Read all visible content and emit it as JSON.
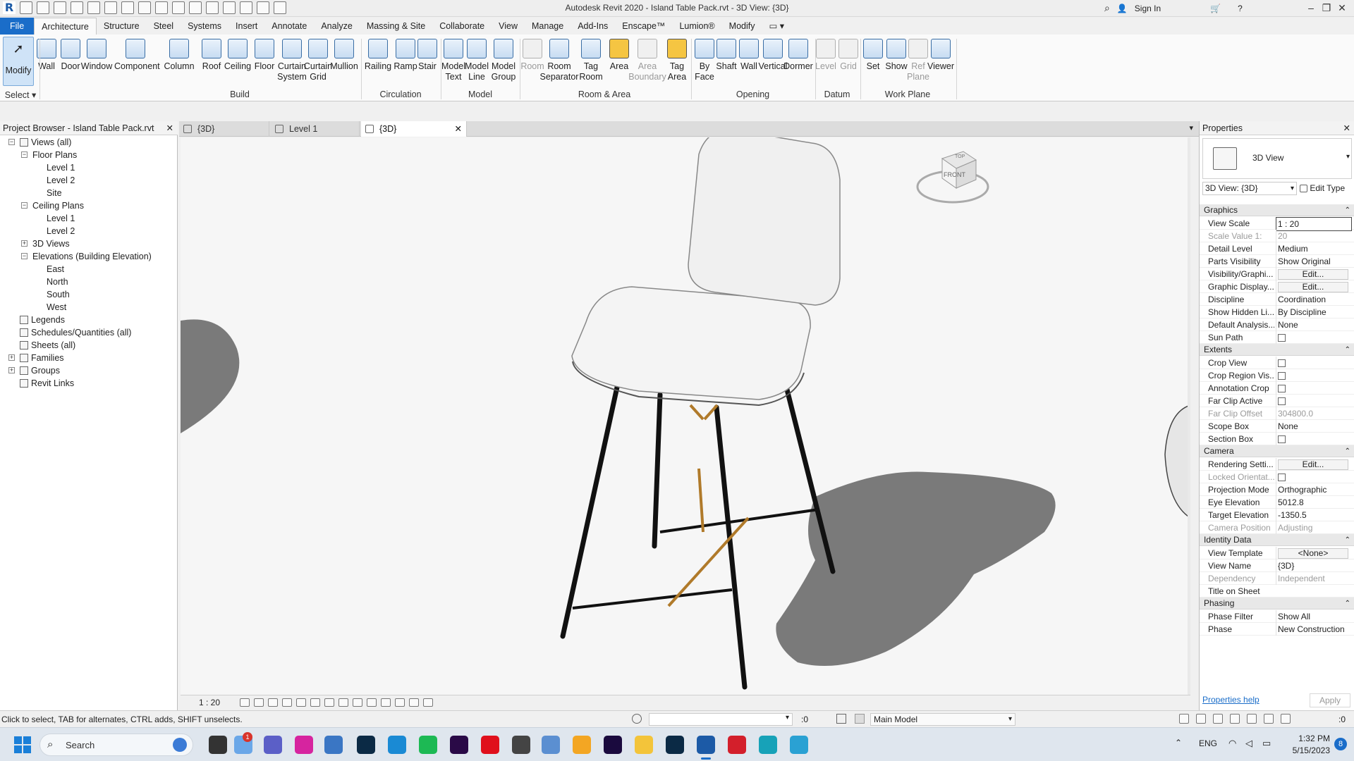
{
  "titlebar": {
    "app_title": "Autodesk Revit 2020 - Island Table Pack.rvt - 3D View: {3D}",
    "sign_in": "Sign In",
    "minimize": "–",
    "restore": "❐",
    "close": "✕"
  },
  "ribbon_tabs": [
    "File",
    "Architecture",
    "Structure",
    "Steel",
    "Systems",
    "Insert",
    "Annotate",
    "Analyze",
    "Massing & Site",
    "Collaborate",
    "View",
    "Manage",
    "Add-Ins",
    "Enscape™",
    "Lumion®",
    "Modify"
  ],
  "ribbon": {
    "select": {
      "modify": "Modify",
      "label": "Select"
    },
    "build": {
      "label": "Build",
      "buttons": [
        "Wall",
        "Door",
        "Window",
        "Component",
        "Column",
        "Roof",
        "Ceiling",
        "Floor",
        "Curtain\nSystem",
        "Curtain\nGrid",
        "Mullion"
      ]
    },
    "circulation": {
      "label": "Circulation",
      "buttons": [
        "Railing",
        "Ramp",
        "Stair"
      ]
    },
    "model": {
      "label": "Model",
      "buttons": [
        "Model\nText",
        "Model\nLine",
        "Model\nGroup"
      ]
    },
    "room_area": {
      "label": "Room & Area",
      "buttons": [
        "Room",
        "Room\nSeparator",
        "Tag\nRoom",
        "Area",
        "Area\nBoundary",
        "Tag\nArea"
      ]
    },
    "opening": {
      "label": "Opening",
      "buttons": [
        "By\nFace",
        "Shaft",
        "Wall",
        "Vertical",
        "Dormer"
      ]
    },
    "datum": {
      "label": "Datum",
      "buttons": [
        "Level",
        "Grid"
      ]
    },
    "work_plane": {
      "label": "Work Plane",
      "buttons": [
        "Set",
        "Show",
        "Ref\nPlane",
        "Viewer"
      ]
    }
  },
  "project_browser": {
    "title": "Project Browser - Island Table Pack.rvt",
    "close": "✕",
    "tree": [
      {
        "label": "Views (all)",
        "level": 0,
        "toggle": "−"
      },
      {
        "label": "Floor Plans",
        "level": 1,
        "toggle": "−"
      },
      {
        "label": "Level 1",
        "level": 2
      },
      {
        "label": "Level 2",
        "level": 2
      },
      {
        "label": "Site",
        "level": 2
      },
      {
        "label": "Ceiling Plans",
        "level": 1,
        "toggle": "−"
      },
      {
        "label": "Level 1",
        "level": 2
      },
      {
        "label": "Level 2",
        "level": 2
      },
      {
        "label": "3D Views",
        "level": 1,
        "toggle": "+"
      },
      {
        "label": "Elevations (Building Elevation)",
        "level": 1,
        "toggle": "−"
      },
      {
        "label": "East",
        "level": 2
      },
      {
        "label": "North",
        "level": 2
      },
      {
        "label": "South",
        "level": 2
      },
      {
        "label": "West",
        "level": 2
      },
      {
        "label": "Legends",
        "level": 0
      },
      {
        "label": "Schedules/Quantities (all)",
        "level": 0
      },
      {
        "label": "Sheets (all)",
        "level": 0
      },
      {
        "label": "Families",
        "level": 0,
        "toggle": "+"
      },
      {
        "label": "Groups",
        "level": 0,
        "toggle": "+"
      },
      {
        "label": "Revit Links",
        "level": 0
      }
    ]
  },
  "view_tabs": [
    {
      "label": "{3D}",
      "active": false
    },
    {
      "label": "Level 1",
      "active": false
    },
    {
      "label": "{3D}",
      "active": true
    }
  ],
  "view_tab_close": "✕",
  "viewcube": {
    "top": "TOP",
    "front": "FRONT"
  },
  "view_control_bar": {
    "scale": "1 : 20"
  },
  "properties": {
    "title": "Properties",
    "close": "✕",
    "type_name": "3D View",
    "selector": "3D View: {3D}",
    "edit_type": "Edit Type",
    "sections": [
      {
        "name": "Graphics",
        "rows": [
          {
            "k": "View Scale",
            "v": "1 : 20",
            "box": true
          },
          {
            "k": "Scale Value    1:",
            "v": "20",
            "dim": true
          },
          {
            "k": "Detail Level",
            "v": "Medium"
          },
          {
            "k": "Parts Visibility",
            "v": "Show Original"
          },
          {
            "k": "Visibility/Graphi...",
            "v": "Edit...",
            "btn": true
          },
          {
            "k": "Graphic Display...",
            "v": "Edit...",
            "btn": true
          },
          {
            "k": "Discipline",
            "v": "Coordination"
          },
          {
            "k": "Show Hidden Li...",
            "v": "By Discipline"
          },
          {
            "k": "Default Analysis...",
            "v": "None"
          },
          {
            "k": "Sun Path",
            "v": "",
            "check": true
          }
        ]
      },
      {
        "name": "Extents",
        "rows": [
          {
            "k": "Crop View",
            "v": "",
            "check": true
          },
          {
            "k": "Crop Region Vis...",
            "v": "",
            "check": true
          },
          {
            "k": "Annotation Crop",
            "v": "",
            "check": true
          },
          {
            "k": "Far Clip Active",
            "v": "",
            "check": true
          },
          {
            "k": "Far Clip Offset",
            "v": "304800.0",
            "dim": true
          },
          {
            "k": "Scope Box",
            "v": "None"
          },
          {
            "k": "Section Box",
            "v": "",
            "check": true
          }
        ]
      },
      {
        "name": "Camera",
        "rows": [
          {
            "k": "Rendering Setti...",
            "v": "Edit...",
            "btn": true
          },
          {
            "k": "Locked Orientat...",
            "v": "",
            "check": true,
            "dim": true
          },
          {
            "k": "Projection Mode",
            "v": "Orthographic"
          },
          {
            "k": "Eye Elevation",
            "v": "5012.8"
          },
          {
            "k": "Target Elevation",
            "v": "-1350.5"
          },
          {
            "k": "Camera Position",
            "v": "Adjusting",
            "dim": true
          }
        ]
      },
      {
        "name": "Identity Data",
        "rows": [
          {
            "k": "View Template",
            "v": "<None>",
            "btn": true
          },
          {
            "k": "View Name",
            "v": "{3D}"
          },
          {
            "k": "Dependency",
            "v": "Independent",
            "dim": true
          },
          {
            "k": "Title on Sheet",
            "v": ""
          }
        ]
      },
      {
        "name": "Phasing",
        "rows": [
          {
            "k": "Phase Filter",
            "v": "Show All"
          },
          {
            "k": "Phase",
            "v": "New Construction"
          }
        ]
      }
    ],
    "help": "Properties help",
    "apply": "Apply"
  },
  "statusbar": {
    "hint": "Click to select, TAB for alternates, CTRL adds, SHIFT unselects.",
    "filter_count": ":0",
    "model": "Main Model",
    "selection_count": ":0"
  },
  "taskbar": {
    "search": "Search",
    "lang": "ENG",
    "time": "1:32 PM",
    "date": "5/15/2023",
    "notif_count": "8",
    "badge": "1"
  },
  "colors": {
    "accent": "#1a6dc9",
    "seat": "#f4f4f4",
    "legs": "#111111",
    "stretcher": "#b07a2a",
    "shadow": "#7a7a7a"
  }
}
